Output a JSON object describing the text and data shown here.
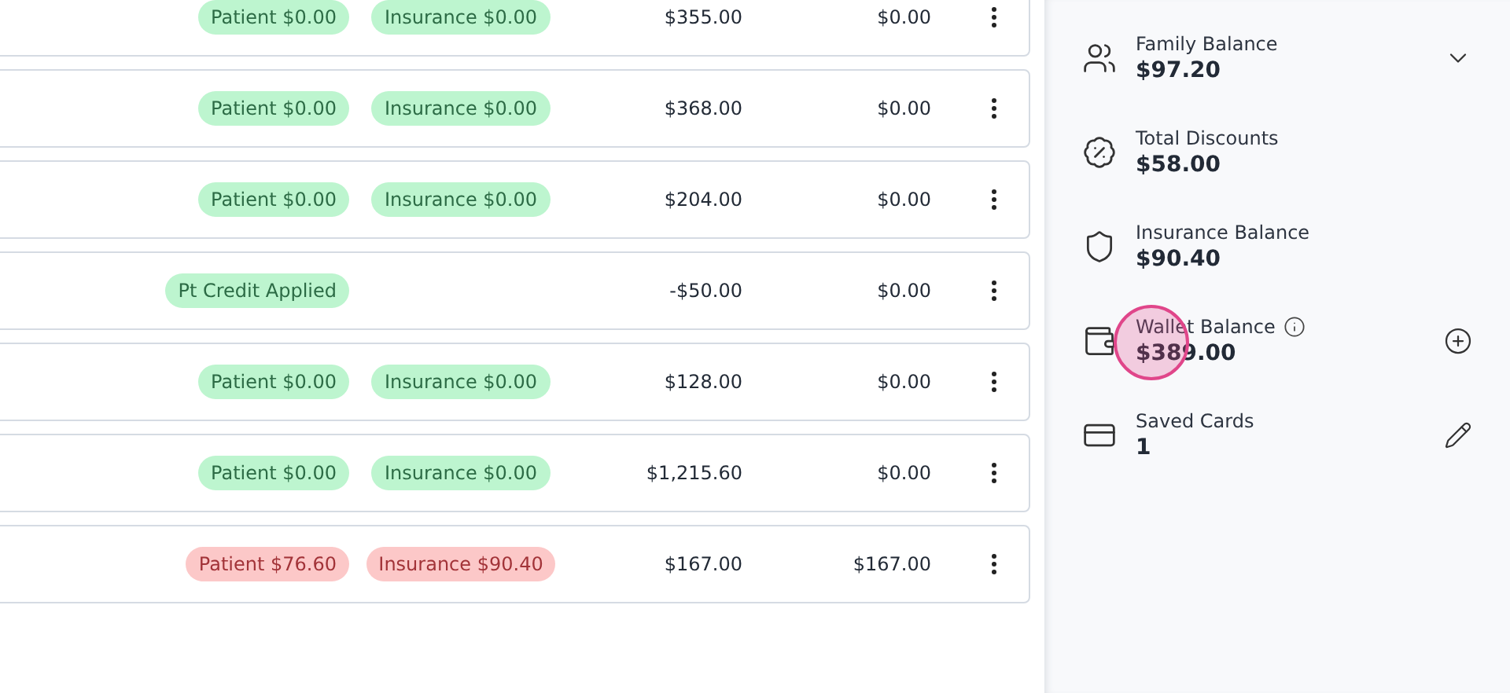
{
  "ledger_rows": [
    {
      "patient_pill": {
        "text": "Patient $0.00",
        "kind": "paid"
      },
      "insurance_pill": {
        "text": "Insurance $0.00",
        "kind": "paid"
      },
      "amount": "$355.00",
      "balance": "$0.00"
    },
    {
      "patient_pill": {
        "text": "Patient $0.00",
        "kind": "paid"
      },
      "insurance_pill": {
        "text": "Insurance $0.00",
        "kind": "paid"
      },
      "amount": "$368.00",
      "balance": "$0.00"
    },
    {
      "patient_pill": {
        "text": "Patient $0.00",
        "kind": "paid"
      },
      "insurance_pill": {
        "text": "Insurance $0.00",
        "kind": "paid"
      },
      "amount": "$204.00",
      "balance": "$0.00"
    },
    {
      "patient_pill": {
        "text": "Pt Credit Applied",
        "kind": "paid"
      },
      "amount": "-$50.00",
      "balance": "$0.00"
    },
    {
      "patient_pill": {
        "text": "Patient $0.00",
        "kind": "paid"
      },
      "insurance_pill": {
        "text": "Insurance $0.00",
        "kind": "paid"
      },
      "amount": "$128.00",
      "balance": "$0.00"
    },
    {
      "patient_pill": {
        "text": "Patient $0.00",
        "kind": "paid"
      },
      "insurance_pill": {
        "text": "Insurance $0.00",
        "kind": "paid"
      },
      "amount": "$1,215.60",
      "balance": "$0.00"
    },
    {
      "patient_pill": {
        "text": "Patient $76.60",
        "kind": "due"
      },
      "insurance_pill": {
        "text": "Insurance $90.40",
        "kind": "due"
      },
      "amount": "$167.00",
      "balance": "$167.00"
    }
  ],
  "balances": [
    {
      "kind": "family",
      "label": "Family Balance",
      "value": "$97.20"
    },
    {
      "kind": "discount",
      "label": "Total Discounts",
      "value": "$58.00"
    },
    {
      "kind": "insurance",
      "label": "Insurance Balance",
      "value": "$90.40"
    },
    {
      "kind": "wallet",
      "label": "Wallet Balance",
      "value": "$389.00",
      "info": true,
      "touched": true
    },
    {
      "kind": "card",
      "label": "Saved Cards",
      "value": "1"
    }
  ]
}
